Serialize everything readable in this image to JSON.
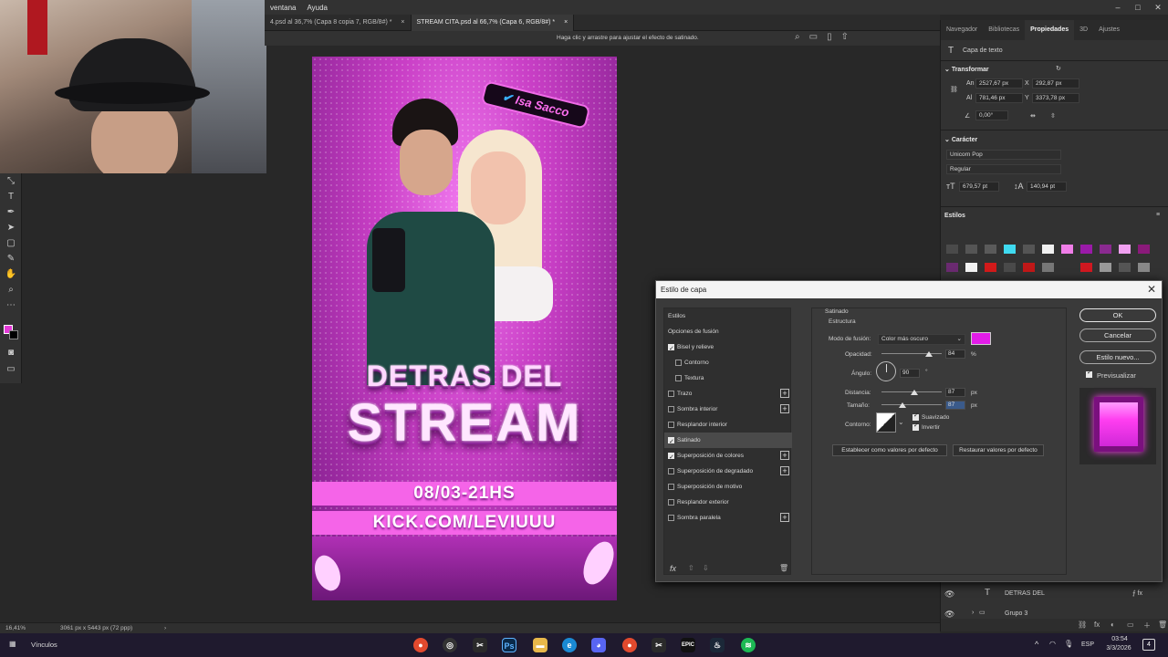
{
  "menu": {
    "items": [
      "ventana",
      "Ayuda"
    ]
  },
  "tabs": [
    {
      "label": "4.psd al 36,7% (Capa 8 copia 7, RGB/8#) *",
      "close": "×"
    },
    {
      "label": "STREAM CITA.psd al 66,7% (Capa 6, RGB/8#) *",
      "close": "×"
    }
  ],
  "options_bar": {
    "hint": "Haga clic y arrastre para ajustar el efecto de satinado."
  },
  "canvas": {
    "badge": "Isa Sacco",
    "title_line1": "DETRAS DEL",
    "title_line2": "STREAM",
    "date": "08/03-21HS",
    "url": "KICK.COM/LEVIUUU"
  },
  "status": {
    "zoom": "16,41%",
    "doc_size": "3061 px x 5443 px (72 ppp)"
  },
  "right_panel": {
    "tabs": [
      "Navegador",
      "Bibliotecas",
      "Propiedades",
      "3D",
      "Ajustes"
    ],
    "active_tab": "Propiedades",
    "layer_kind": "Capa de texto",
    "transform_header": "Transformar",
    "an_label": "An",
    "an_value": "2527,67 px",
    "al_label": "Al",
    "al_value": "781,46 px",
    "x_label": "X",
    "x_value": "292,87 px",
    "y_label": "Y",
    "y_value": "3373,78 px",
    "angle_value": "0,00°",
    "char_header": "Carácter",
    "font": "Unicorn Pop",
    "style": "Regular",
    "size": "679,57 pt",
    "leading": "140,94 pt",
    "styles_header": "Estilos",
    "layers": [
      {
        "name": "DETRAS DEL"
      },
      {
        "name": "Grupo 3"
      }
    ]
  },
  "dialog": {
    "title": "Estilo de capa",
    "list": [
      {
        "label": "Estilos",
        "type": "header"
      },
      {
        "label": "Opciones de fusión",
        "type": "header"
      },
      {
        "label": "Bisel y relieve",
        "checked": true
      },
      {
        "label": "Contorno",
        "checked": false,
        "indent": true
      },
      {
        "label": "Textura",
        "checked": false,
        "indent": true
      },
      {
        "label": "Trazo",
        "checked": false,
        "plus": true
      },
      {
        "label": "Sombra interior",
        "checked": false,
        "plus": true
      },
      {
        "label": "Resplandor interior",
        "checked": false
      },
      {
        "label": "Satinado",
        "checked": true,
        "selected": true
      },
      {
        "label": "Superposición de colores",
        "checked": true,
        "plus": true
      },
      {
        "label": "Superposición de degradado",
        "checked": false,
        "plus": true
      },
      {
        "label": "Superposición de motivo",
        "checked": false
      },
      {
        "label": "Resplandor exterior",
        "checked": false
      },
      {
        "label": "Sombra paralela",
        "checked": false,
        "plus": true
      }
    ],
    "section": "Satinado",
    "subsection": "Estructura",
    "blend_label": "Modo de fusión:",
    "blend_value": "Color más oscuro",
    "blend_color": "#e21ce8",
    "opacity_label": "Opacidad:",
    "opacity_value": "84",
    "opacity_unit": "%",
    "angle_label": "Ángulo:",
    "angle_value": "90",
    "angle_unit": "°",
    "distance_label": "Distancia:",
    "distance_value": "87",
    "distance_unit": "px",
    "size_label": "Tamaño:",
    "size_value": "87",
    "size_unit": "px",
    "contour_label": "Contorno:",
    "smooth_label": "Suavizado",
    "invert_label": "Invertir",
    "btn_set_default": "Establecer como valores por defecto",
    "btn_reset_default": "Restaurar valores por defecto",
    "ok": "OK",
    "cancel": "Cancelar",
    "new_style": "Estilo nuevo...",
    "preview": "Previsualizar",
    "fx": "fx"
  },
  "taskbar": {
    "vinculos": "Vínculos",
    "lang": "ESP",
    "time": "03:54",
    "date": "3/3/2026",
    "notif": "4"
  }
}
